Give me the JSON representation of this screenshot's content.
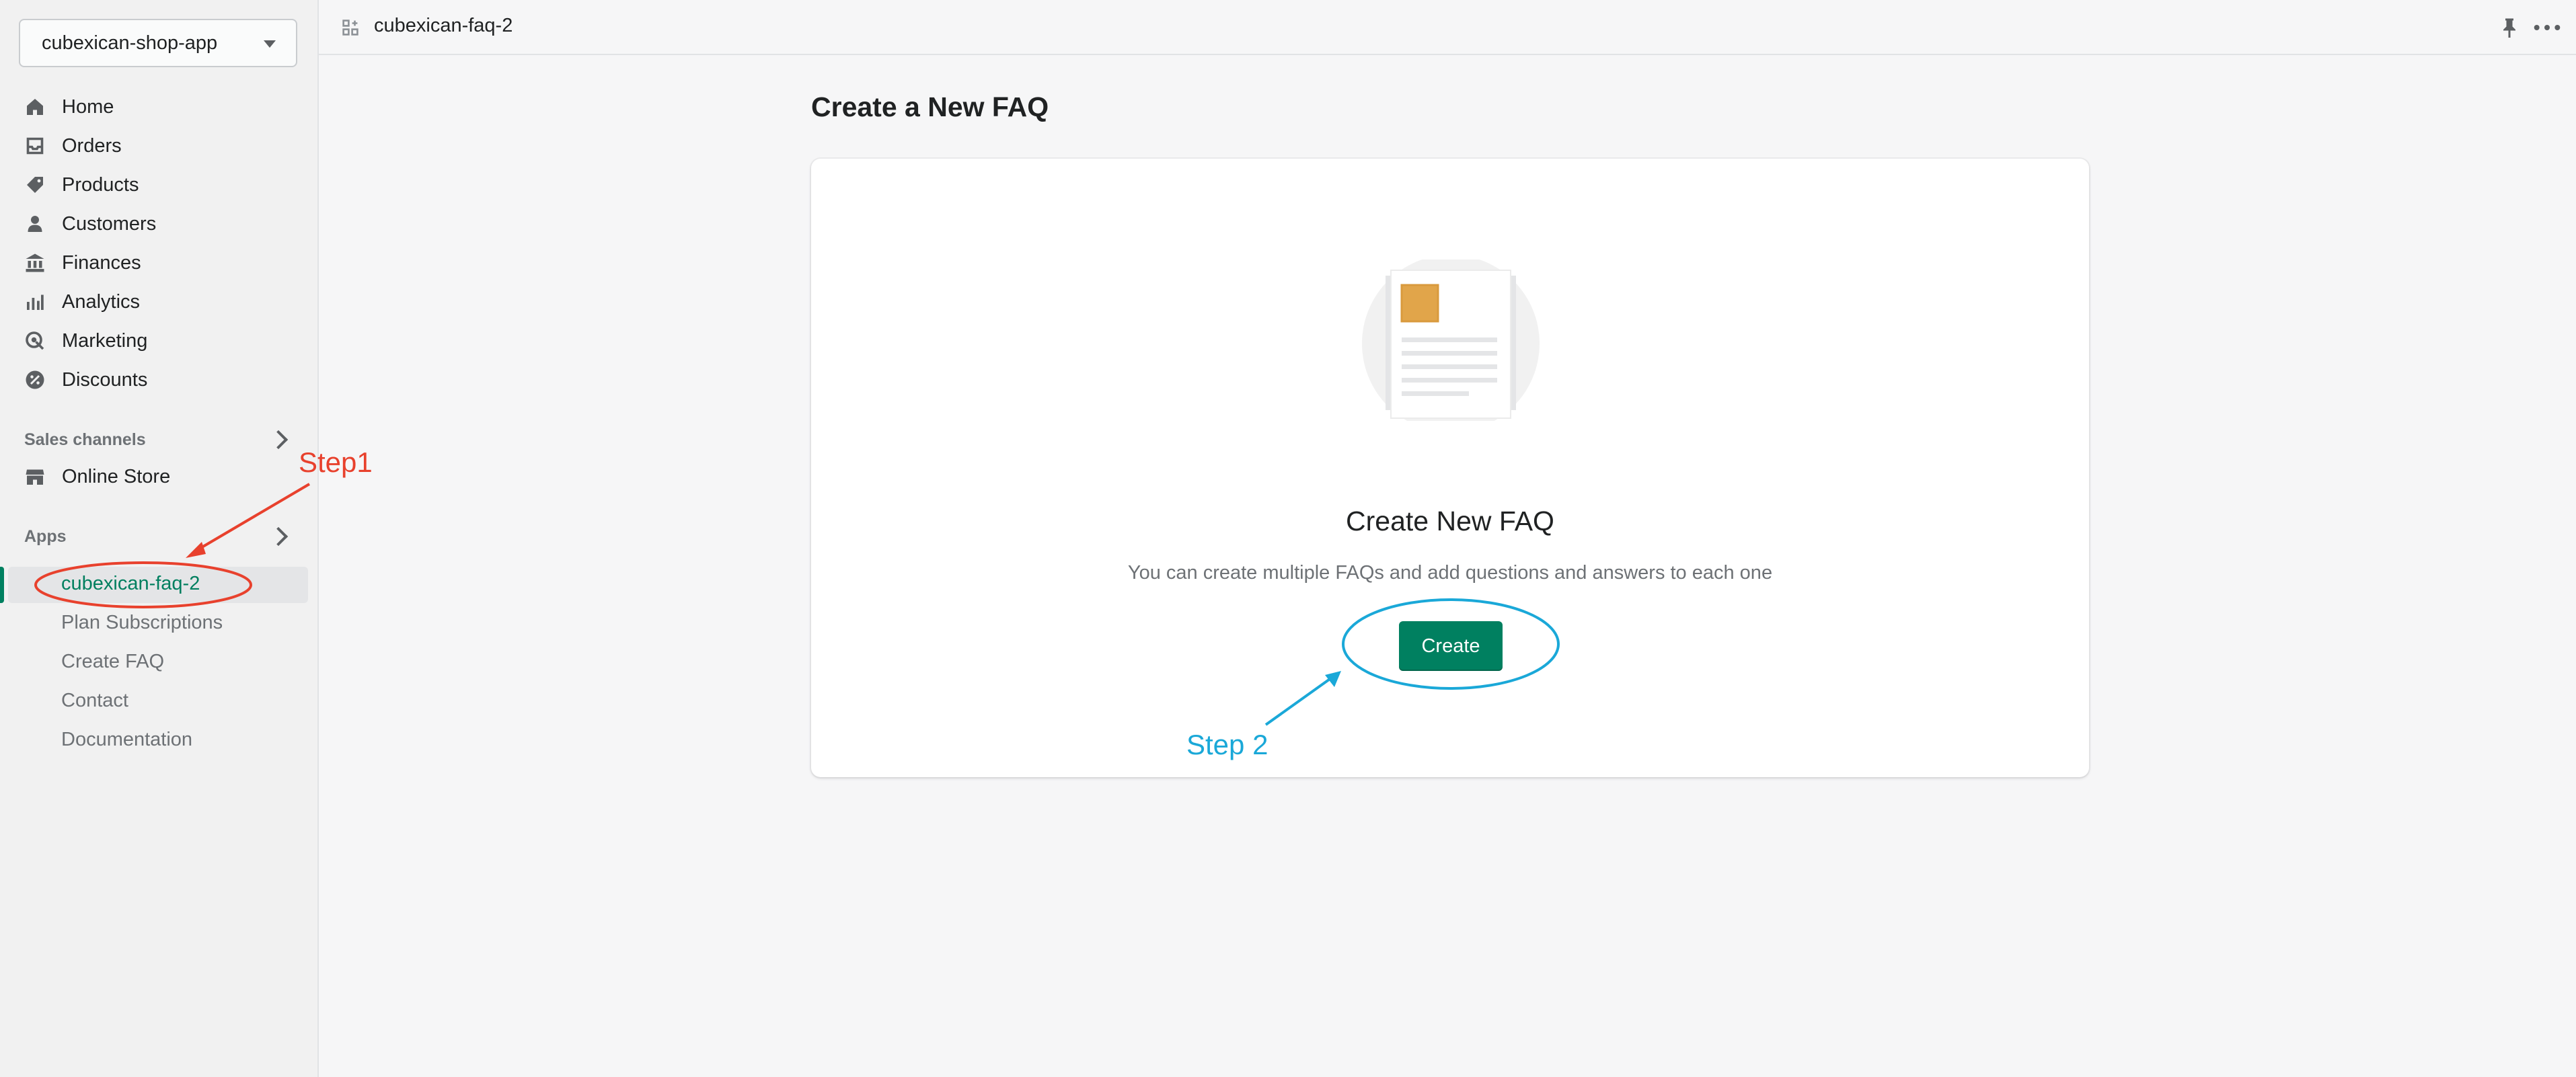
{
  "store": {
    "name": "cubexican-shop-app"
  },
  "nav": {
    "items": [
      {
        "label": "Home",
        "icon": "home-icon"
      },
      {
        "label": "Orders",
        "icon": "inbox-icon"
      },
      {
        "label": "Products",
        "icon": "tag-icon"
      },
      {
        "label": "Customers",
        "icon": "person-icon"
      },
      {
        "label": "Finances",
        "icon": "bank-icon"
      },
      {
        "label": "Analytics",
        "icon": "bar-chart-icon"
      },
      {
        "label": "Marketing",
        "icon": "target-icon"
      },
      {
        "label": "Discounts",
        "icon": "discount-icon"
      }
    ],
    "sales_channels_label": "Sales channels",
    "online_store": {
      "label": "Online Store",
      "icon": "store-icon"
    },
    "apps_label": "Apps",
    "app_items": [
      {
        "label": "cubexican-faq-2"
      },
      {
        "label": "Plan Subscriptions"
      },
      {
        "label": "Create FAQ"
      },
      {
        "label": "Contact"
      },
      {
        "label": "Documentation"
      }
    ]
  },
  "topbar": {
    "title": "cubexican-faq-2"
  },
  "main": {
    "page_title": "Create a New FAQ",
    "empty_state": {
      "heading": "Create New FAQ",
      "description": "You can create multiple FAQs and add questions and answers to each one",
      "button_label": "Create"
    }
  },
  "annotations": {
    "step1": "Step1",
    "step2": "Step 2",
    "step1_color": "#e8412d",
    "step2_color": "#1aa8d8"
  },
  "colors": {
    "accent": "#008060",
    "active_app_text": "#007f5f"
  }
}
